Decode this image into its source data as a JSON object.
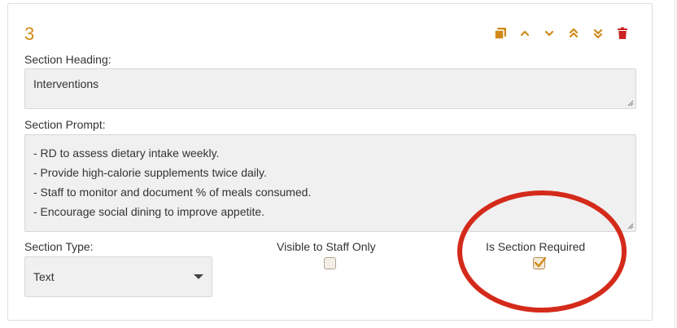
{
  "section": {
    "number": "3",
    "heading_label": "Section Heading:",
    "heading_value": "Interventions",
    "prompt_label": "Section Prompt:",
    "prompt_lines": [
      "- RD to assess dietary intake weekly.",
      "- Provide high-calorie supplements twice daily.",
      "- Staff to monitor and document % of meals consumed.",
      "- Encourage social dining to improve appetite."
    ],
    "type_label": "Section Type:",
    "type_value": "Text",
    "visible_label": "Visible to Staff Only",
    "visible_checked": false,
    "required_label": "Is Section Required",
    "required_checked": true
  },
  "toolbar": {
    "icons": [
      "copy-icon",
      "move-up-icon",
      "move-down-icon",
      "move-to-top-icon",
      "move-to-bottom-icon",
      "delete-icon"
    ]
  },
  "colors": {
    "accent": "#d08a1a",
    "delete": "#cc2222",
    "annotation": "#d42a1a"
  }
}
